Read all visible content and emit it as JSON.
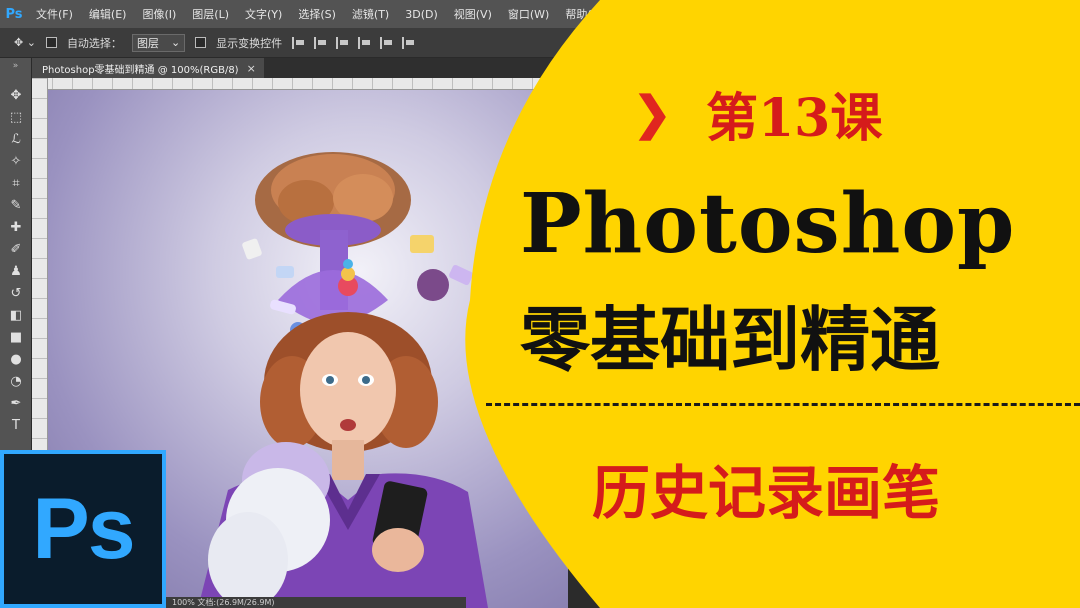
{
  "app": {
    "logo": "Ps",
    "menu": [
      "文件(F)",
      "编辑(E)",
      "图像(I)",
      "图层(L)",
      "文字(Y)",
      "选择(S)",
      "滤镜(T)",
      "3D(D)",
      "视图(V)",
      "窗口(W)",
      "帮助(H)"
    ]
  },
  "options_bar": {
    "auto_select_label": "自动选择：",
    "auto_select_value": "图层",
    "show_transform_label": "显示变换控件"
  },
  "document": {
    "tab_title": "Photoshop零基础到精通 @ 100%(RGB/8)",
    "close_glyph": "×",
    "status_text": "100%    文档:(26.9M/26.9M)"
  },
  "toolbar": {
    "grip": "»",
    "tools": [
      {
        "name": "move-tool-icon",
        "glyph": "✥"
      },
      {
        "name": "marquee-tool-icon",
        "glyph": "⬚"
      },
      {
        "name": "lasso-tool-icon",
        "glyph": "ℒ"
      },
      {
        "name": "magic-wand-tool-icon",
        "glyph": "✧"
      },
      {
        "name": "crop-tool-icon",
        "glyph": "⌗"
      },
      {
        "name": "eyedropper-tool-icon",
        "glyph": "✎"
      },
      {
        "name": "healing-brush-tool-icon",
        "glyph": "✚"
      },
      {
        "name": "brush-tool-icon",
        "glyph": "✐"
      },
      {
        "name": "stamp-tool-icon",
        "glyph": "♟"
      },
      {
        "name": "history-brush-tool-icon",
        "glyph": "↺"
      },
      {
        "name": "eraser-tool-icon",
        "glyph": "◧"
      },
      {
        "name": "gradient-tool-icon",
        "glyph": "■"
      },
      {
        "name": "blur-tool-icon",
        "glyph": "●"
      },
      {
        "name": "dodge-tool-icon",
        "glyph": "◔"
      },
      {
        "name": "pen-tool-icon",
        "glyph": "✒"
      },
      {
        "name": "type-tool-icon",
        "glyph": "T"
      }
    ]
  },
  "promo": {
    "arrow": "❯",
    "lesson": "第13课",
    "title_en": "Photoshop",
    "title_cn": "零基础到精通",
    "topic": "历史记录画笔",
    "panel_color": "#ffd400",
    "accent_color": "#d51b1b"
  },
  "badge": {
    "text": "Ps",
    "color": "#31a8ff"
  }
}
